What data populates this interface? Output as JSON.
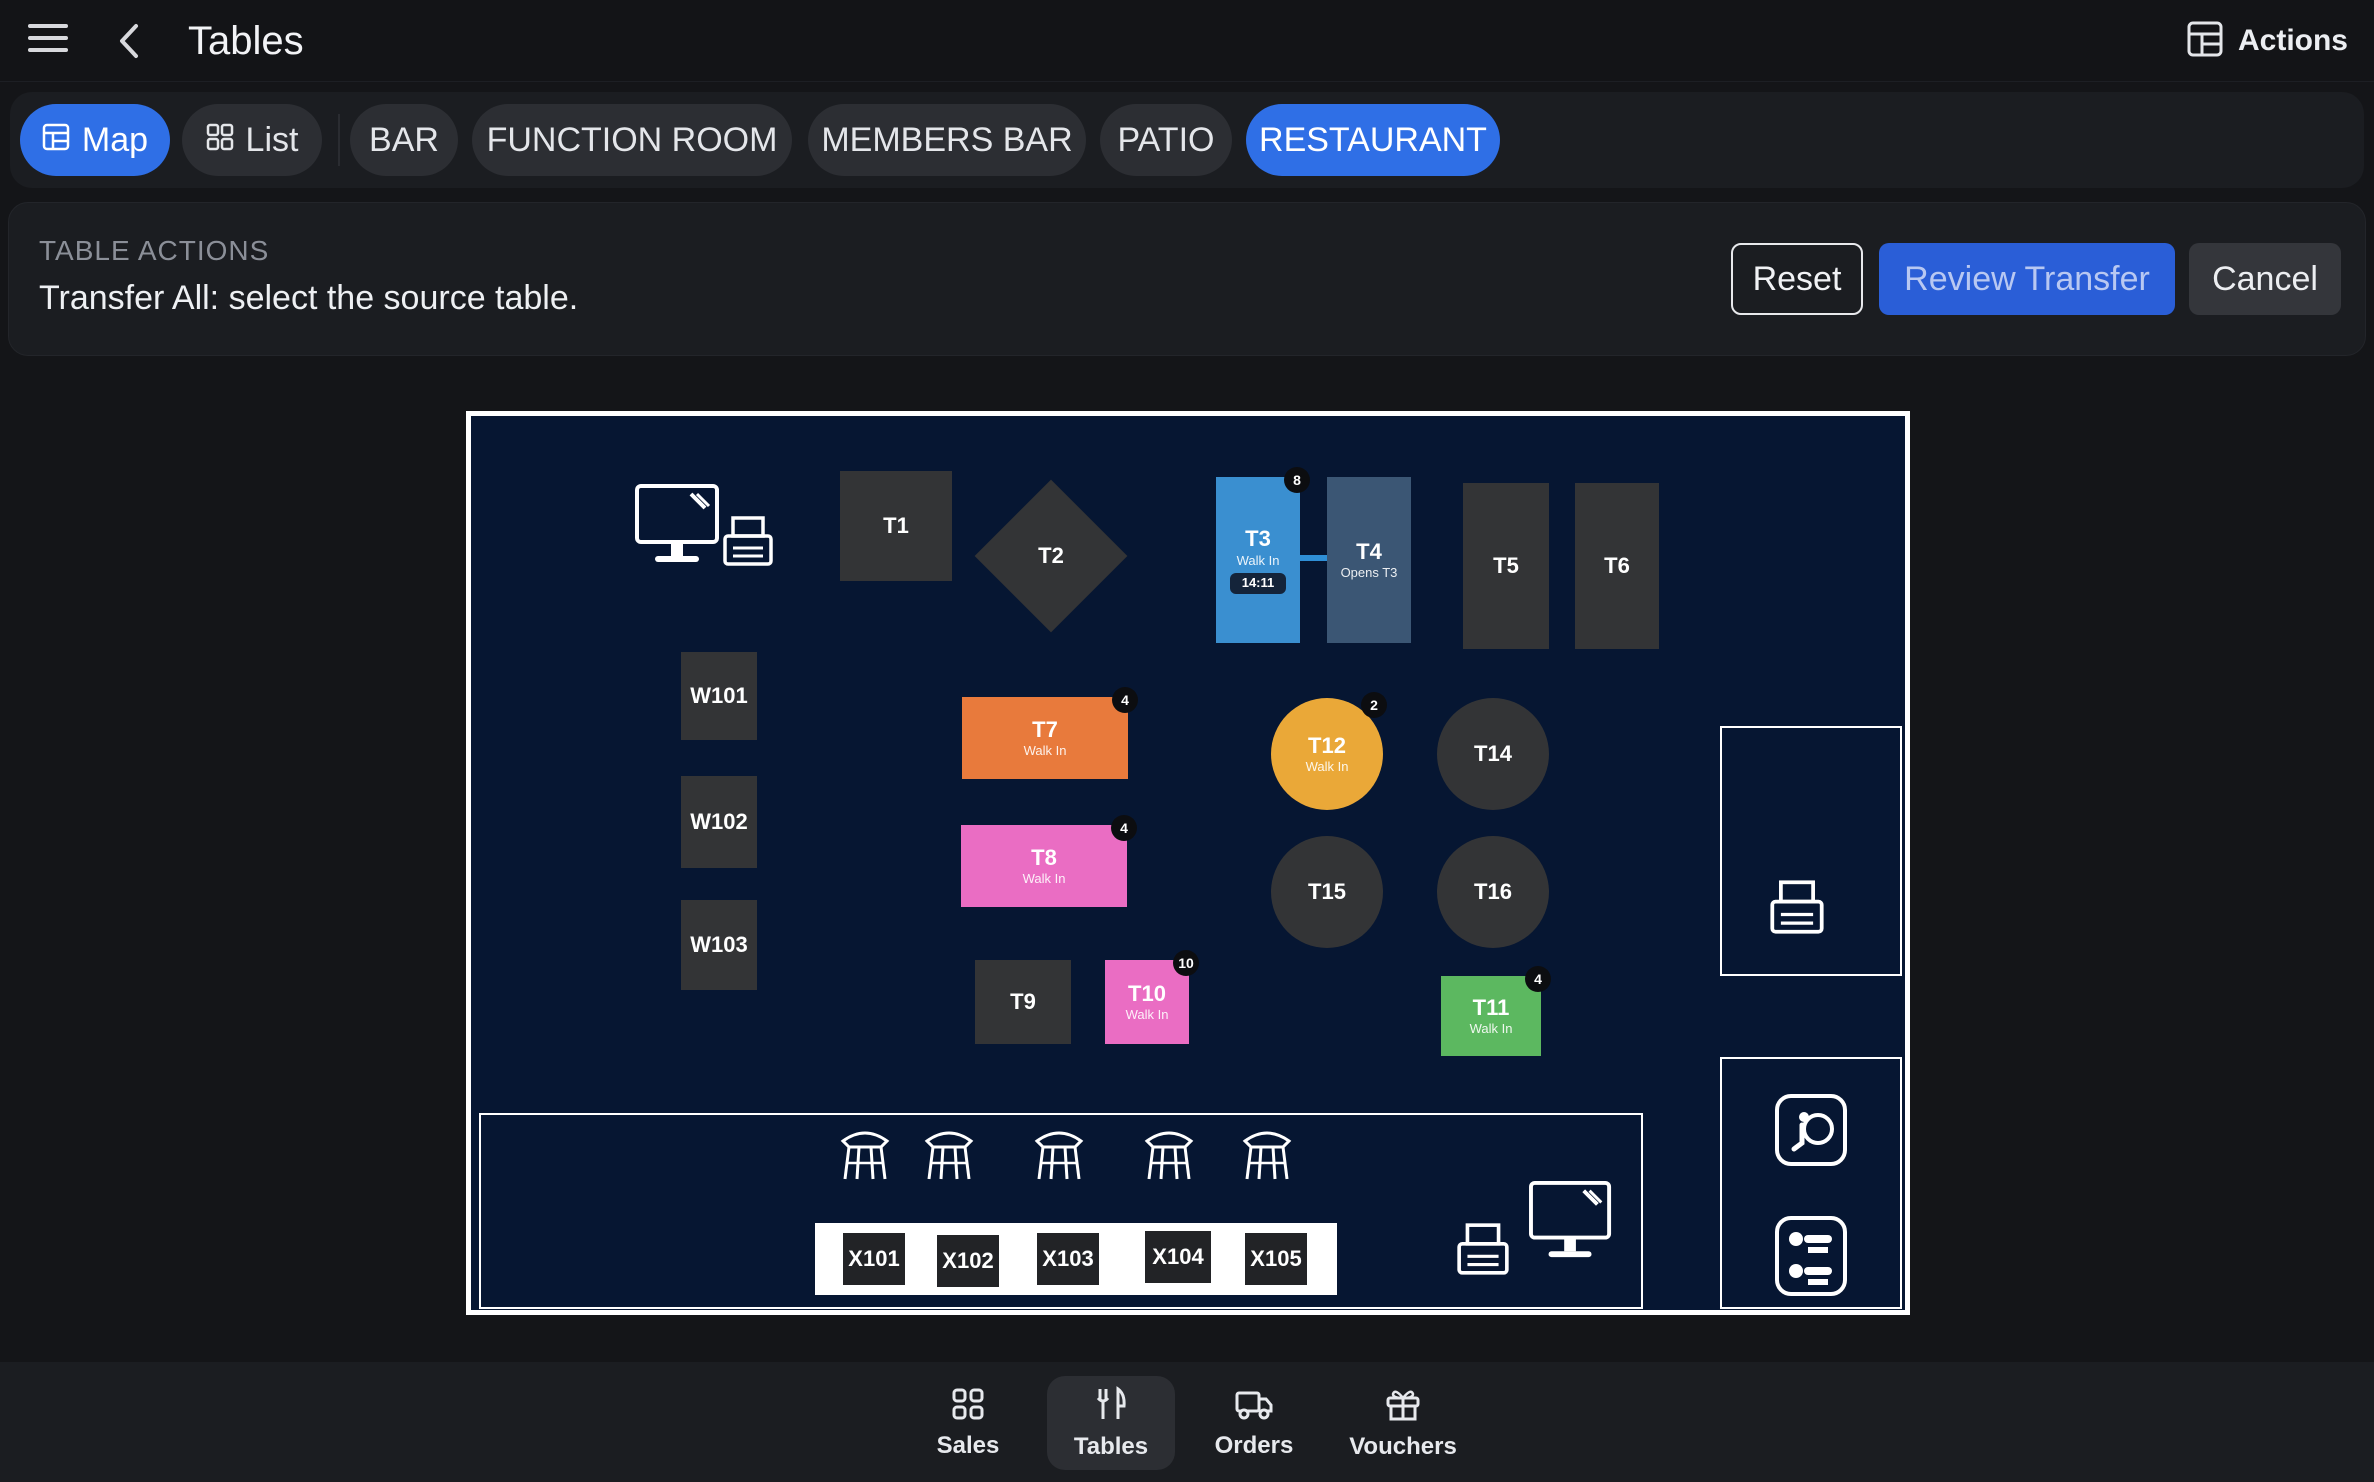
{
  "header": {
    "title": "Tables",
    "actions_label": "Actions"
  },
  "tabs": [
    {
      "label": "Map",
      "icon": "map-icon",
      "active": true
    },
    {
      "label": "List",
      "icon": "grid-icon",
      "active": false
    },
    {
      "label": "BAR",
      "active": false
    },
    {
      "label": "FUNCTION ROOM",
      "active": false
    },
    {
      "label": "MEMBERS BAR",
      "active": false
    },
    {
      "label": "PATIO",
      "active": false
    },
    {
      "label": "RESTAURANT",
      "active": true
    }
  ],
  "table_actions": {
    "heading": "TABLE ACTIONS",
    "message": "Transfer All: select the source table.",
    "reset_label": "Reset",
    "review_label": "Review Transfer",
    "cancel_label": "Cancel"
  },
  "floor_plan": {
    "tables": {
      "T1": {
        "name": "T1"
      },
      "T2": {
        "name": "T2"
      },
      "T3": {
        "name": "T3",
        "status": "Walk In",
        "time": "14:11",
        "guests": "8",
        "color": "#3a8fd0"
      },
      "T4": {
        "name": "T4",
        "status": "Opens T3",
        "color": "#3b5674"
      },
      "T5": {
        "name": "T5"
      },
      "T6": {
        "name": "T6"
      },
      "T7": {
        "name": "T7",
        "status": "Walk In",
        "guests": "4",
        "color": "#e87a3c"
      },
      "T8": {
        "name": "T8",
        "status": "Walk In",
        "guests": "4",
        "color": "#ea6dc3"
      },
      "T9": {
        "name": "T9"
      },
      "T10": {
        "name": "T10",
        "status": "Walk In",
        "guests": "10",
        "color": "#ea6dc3"
      },
      "T11": {
        "name": "T11",
        "status": "Walk In",
        "guests": "4",
        "color": "#5cb860"
      },
      "T12": {
        "name": "T12",
        "status": "Walk In",
        "guests": "2",
        "color": "#eaa838"
      },
      "T14": {
        "name": "T14"
      },
      "T15": {
        "name": "T15"
      },
      "T16": {
        "name": "T16"
      },
      "W101": {
        "name": "W101"
      },
      "W102": {
        "name": "W102"
      },
      "W103": {
        "name": "W103"
      },
      "X101": {
        "name": "X101"
      },
      "X102": {
        "name": "X102"
      },
      "X103": {
        "name": "X103"
      },
      "X104": {
        "name": "X104"
      },
      "X105": {
        "name": "X105"
      }
    },
    "icons": [
      "computer-icon",
      "printer-icon",
      "stool-icon",
      "restroom-icon",
      "accessibility-icon"
    ]
  },
  "bottom_nav": [
    {
      "label": "Sales",
      "icon": "grid-icon",
      "active": false
    },
    {
      "label": "Tables",
      "icon": "cutlery-icon",
      "active": true
    },
    {
      "label": "Orders",
      "icon": "delivery-truck-icon",
      "active": false
    },
    {
      "label": "Vouchers",
      "icon": "gift-icon",
      "active": false
    }
  ],
  "colors": {
    "accent": "#2f6fe6",
    "review_button": "#2a5ed7",
    "floor_background": "#061632",
    "empty_table": "#333436"
  }
}
